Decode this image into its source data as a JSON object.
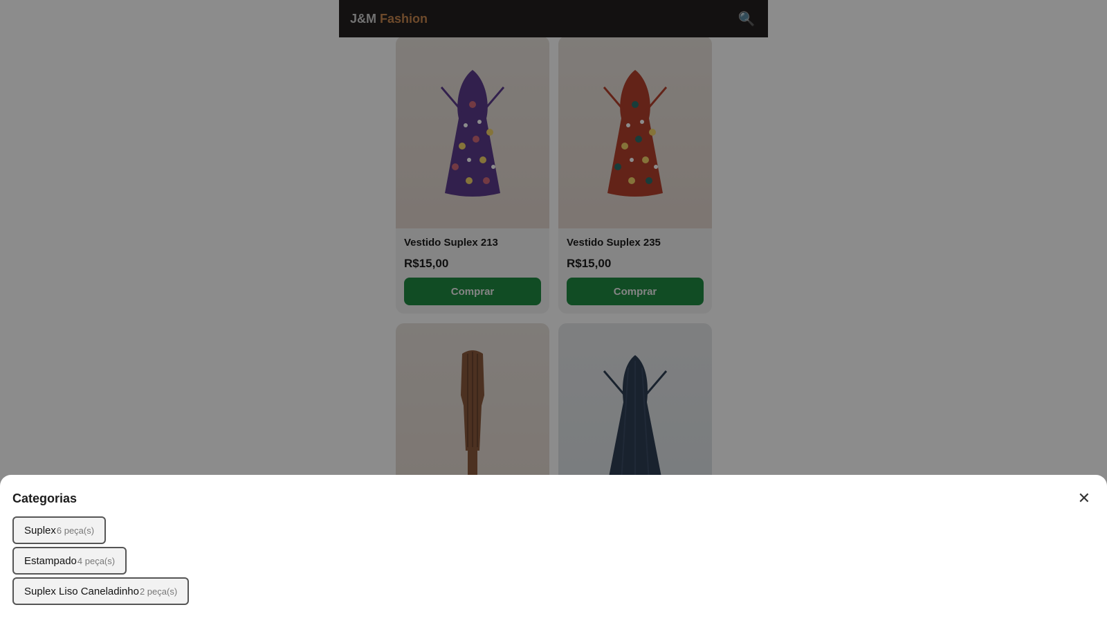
{
  "header": {
    "logo_part1": "J&M",
    "logo_part2": "Fashion",
    "search_icon": "🔍"
  },
  "products": [
    {
      "name": "Vestido Suplex 213",
      "price": "R$15,00",
      "button": "Comprar",
      "image": "purple-polka-dot-dress",
      "color": "#5b3b8c"
    },
    {
      "name": "Vestido Suplex 235",
      "price": "R$15,00",
      "button": "Comprar",
      "image": "red-polka-dot-dress",
      "color": "#b5402d"
    },
    {
      "name": "",
      "price": "",
      "button": "",
      "image": "brown-ribbed-dress",
      "color": "#8a5a3c"
    },
    {
      "name": "",
      "price": "",
      "button": "",
      "image": "navy-ribbed-dress",
      "color": "#2f3f55"
    }
  ],
  "sheet": {
    "title": "Categorias",
    "close_icon": "✕",
    "categories": [
      {
        "name": "Suplex",
        "count": "6 peça(s)"
      },
      {
        "name": "Estampado",
        "count": "4 peça(s)"
      },
      {
        "name": "Suplex Liso Caneladinho",
        "count": "2 peça(s)"
      }
    ]
  },
  "colors": {
    "header_bg": "#231f20",
    "brand_accent": "#c8884f",
    "buy_button": "#1f8a43"
  }
}
